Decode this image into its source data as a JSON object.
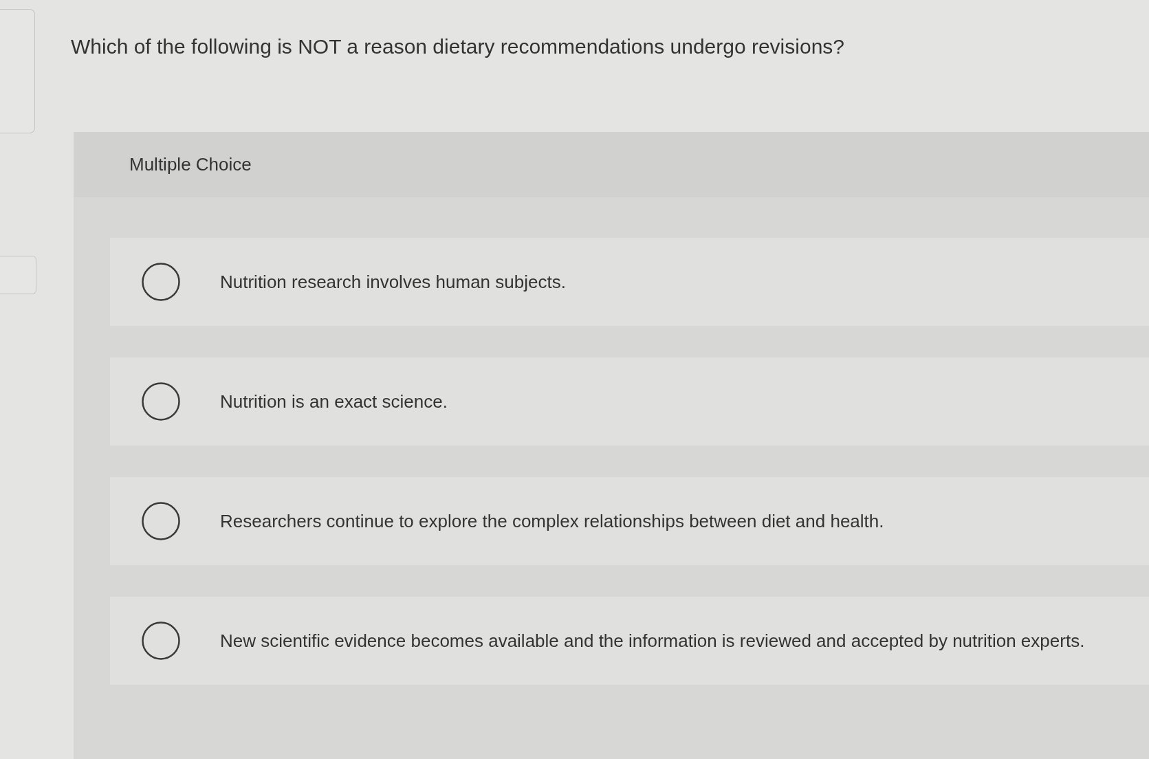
{
  "question": "Which of the following is NOT a reason dietary recommendations undergo revisions?",
  "answer_panel": {
    "heading": "Multiple Choice",
    "options": [
      {
        "text": "Nutrition research involves human subjects.",
        "selected": false
      },
      {
        "text": "Nutrition is an exact science.",
        "selected": false
      },
      {
        "text": "Researchers continue to explore the complex relationships between diet and health.",
        "selected": false
      },
      {
        "text": "New scientific evidence becomes available and the information is reviewed and accepted by nutrition experts.",
        "selected": false
      }
    ]
  }
}
